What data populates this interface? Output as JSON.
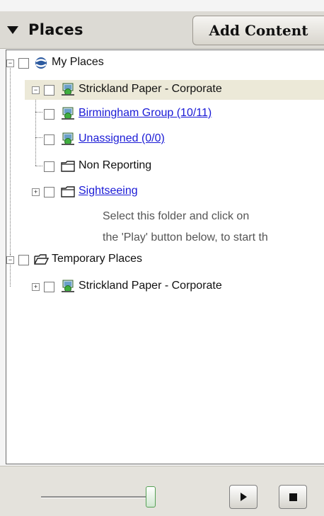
{
  "header": {
    "title": "Places",
    "add_content_label": "Add Content"
  },
  "tree": {
    "my_places": "My Places",
    "strickland_corporate": "Strickland Paper - Corporate",
    "birmingham_group": "Birmingham Group (10/11)",
    "unassigned": "Unassigned (0/0)",
    "non_reporting": "Non Reporting",
    "sightseeing": "Sightseeing",
    "sightseeing_hint_line1": "Select this folder and click on",
    "sightseeing_hint_line2": "the 'Play' button below, to start th",
    "temporary_places": "Temporary Places",
    "temp_strickland_corporate": "Strickland Paper - Corporate"
  },
  "tour": {
    "slider_position": 1.0
  },
  "colors": {
    "header_bg": "#dcdad4",
    "link": "#1a1ad6",
    "selected_row": "#ece9d8"
  },
  "icons": {
    "header_toggle": "triangle-down-icon",
    "my_places": "globe-icon",
    "network_place": "network-monitor-icon",
    "folder": "folder-icon",
    "temporary_places": "open-folder-icon",
    "play": "play-icon",
    "stop": "stop-icon"
  }
}
